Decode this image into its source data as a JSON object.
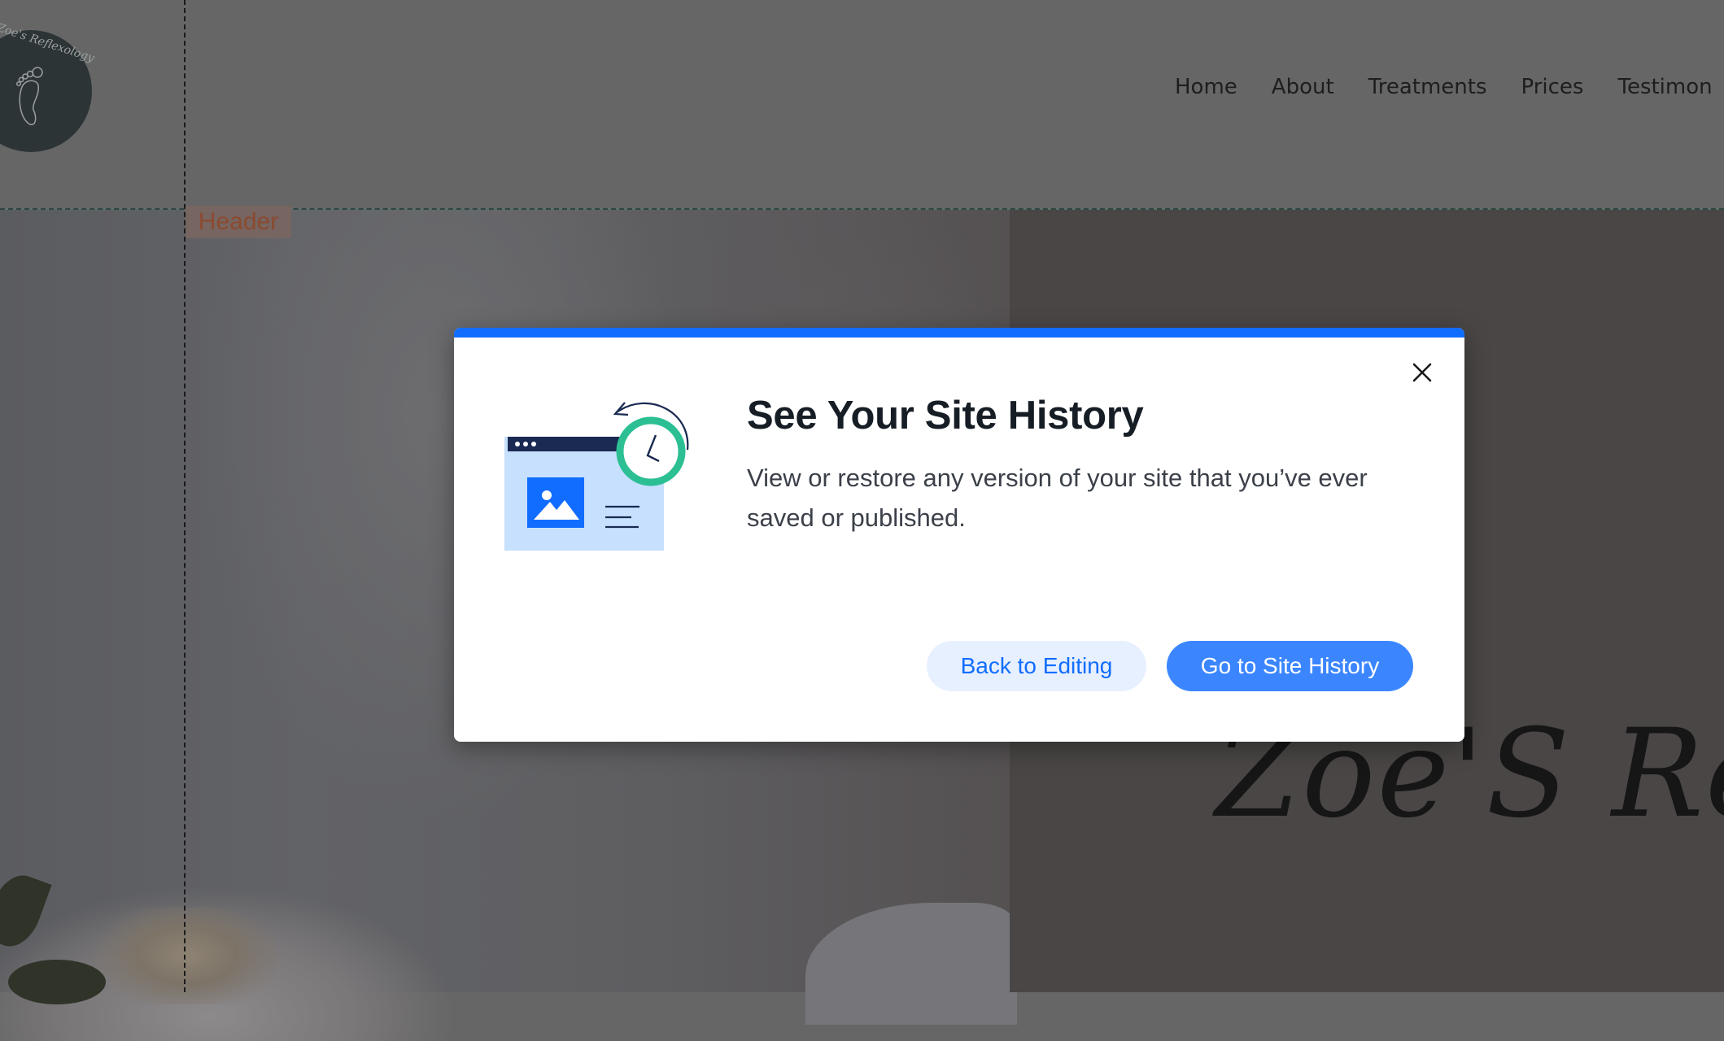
{
  "site": {
    "logo_text": "Zoe's Reflexology",
    "nav": [
      "Home",
      "About",
      "Treatments",
      "Prices",
      "Testimon"
    ],
    "section_label": "Header",
    "hero_script_text": "Zoe'S Refl"
  },
  "dialog": {
    "title": "See Your Site History",
    "body": "View or restore any version of your site that you’ve ever saved or published.",
    "secondary_button": "Back to Editing",
    "primary_button": "Go to Site History",
    "close_icon": "close-icon",
    "illustration": "site-history-illustration",
    "accent_color": "#116dff",
    "clock_color": "#2bbf93"
  }
}
